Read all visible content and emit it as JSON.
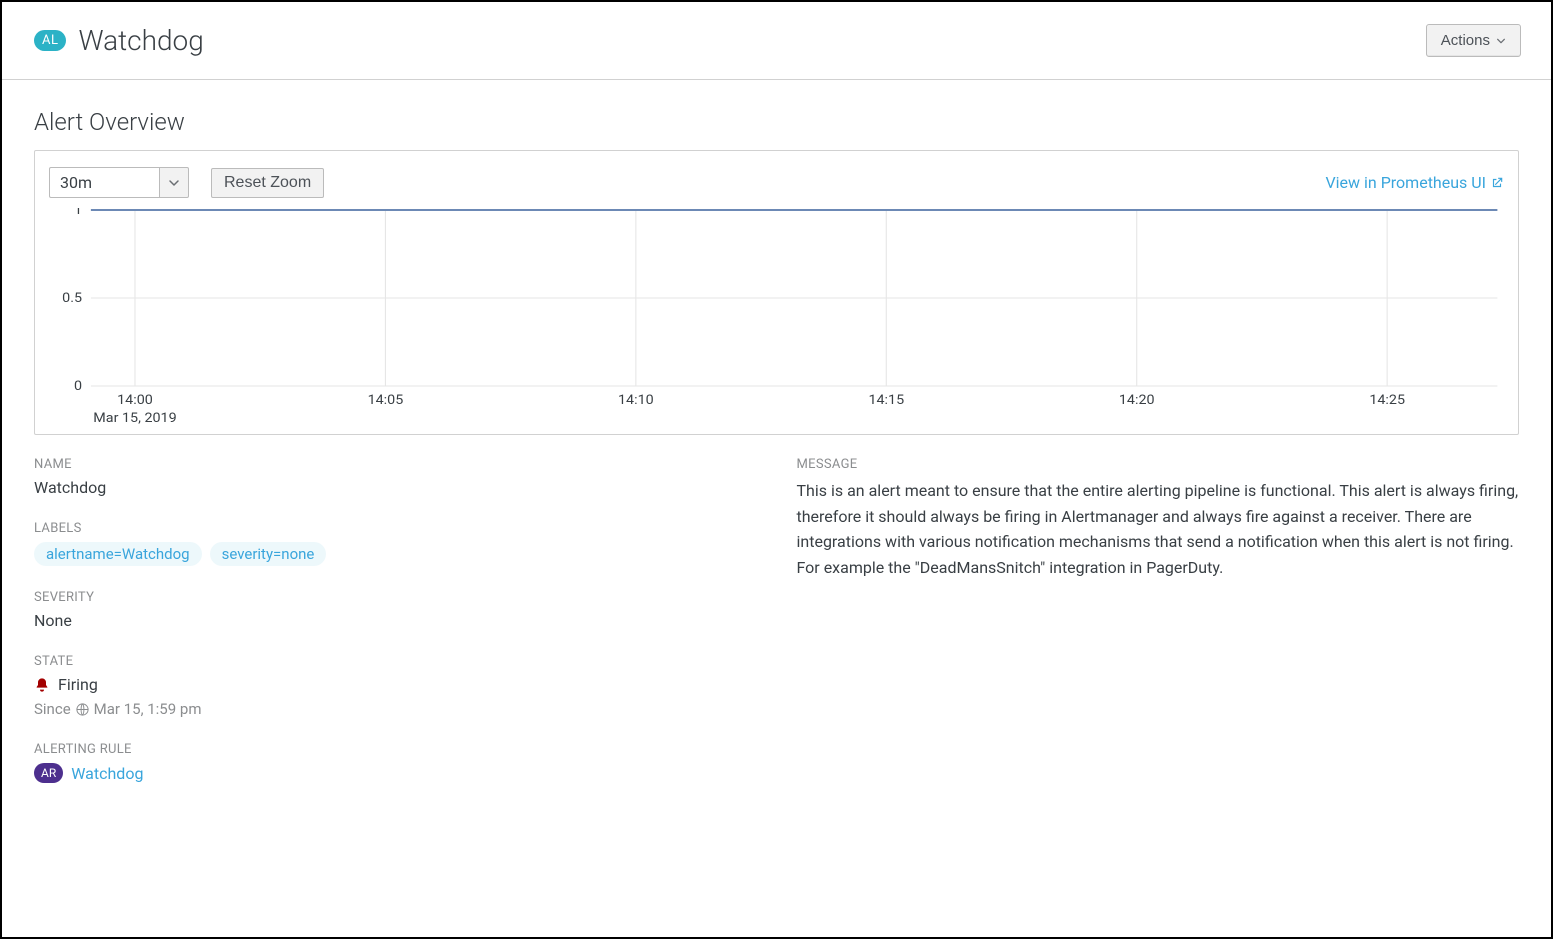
{
  "header": {
    "badge": "AL",
    "title": "Watchdog",
    "actions_label": "Actions"
  },
  "section_title": "Alert Overview",
  "toolbar": {
    "range_value": "30m",
    "reset_label": "Reset Zoom",
    "prom_link": "View in Prometheus UI"
  },
  "fields": {
    "name_label": "NAME",
    "name_value": "Watchdog",
    "labels_label": "LABELS",
    "severity_label": "SEVERITY",
    "severity_value": "None",
    "state_label": "STATE",
    "state_value": "Firing",
    "since_label": "Since",
    "since_value": "Mar 15, 1:59 pm",
    "rule_label": "ALERTING RULE",
    "rule_badge": "AR",
    "rule_link": "Watchdog",
    "message_label": "MESSAGE",
    "message_value": "This is an alert meant to ensure that the entire alerting pipeline is functional. This alert is always firing, therefore it should always be firing in Alertmanager and always fire against a receiver. There are integrations with various notification mechanisms that send a notification when this alert is not firing. For example the \"DeadMansSnitch\" integration in PagerDuty."
  },
  "labels": [
    "alertname=Watchdog",
    "severity=none"
  ],
  "chart_data": {
    "type": "line",
    "title": "",
    "xlabel": "",
    "ylabel": "",
    "ylim": [
      0,
      1
    ],
    "y_ticks": [
      0,
      0.5,
      1
    ],
    "x_ticks": [
      "14:00",
      "14:05",
      "14:10",
      "14:15",
      "14:20",
      "14:25"
    ],
    "x_sub_label": "Mar 15, 2019",
    "series": [
      {
        "name": "Watchdog",
        "color": "#6c89b5",
        "x": [
          "14:00",
          "14:05",
          "14:10",
          "14:15",
          "14:20",
          "14:25"
        ],
        "values": [
          1,
          1,
          1,
          1,
          1,
          1
        ]
      }
    ]
  }
}
